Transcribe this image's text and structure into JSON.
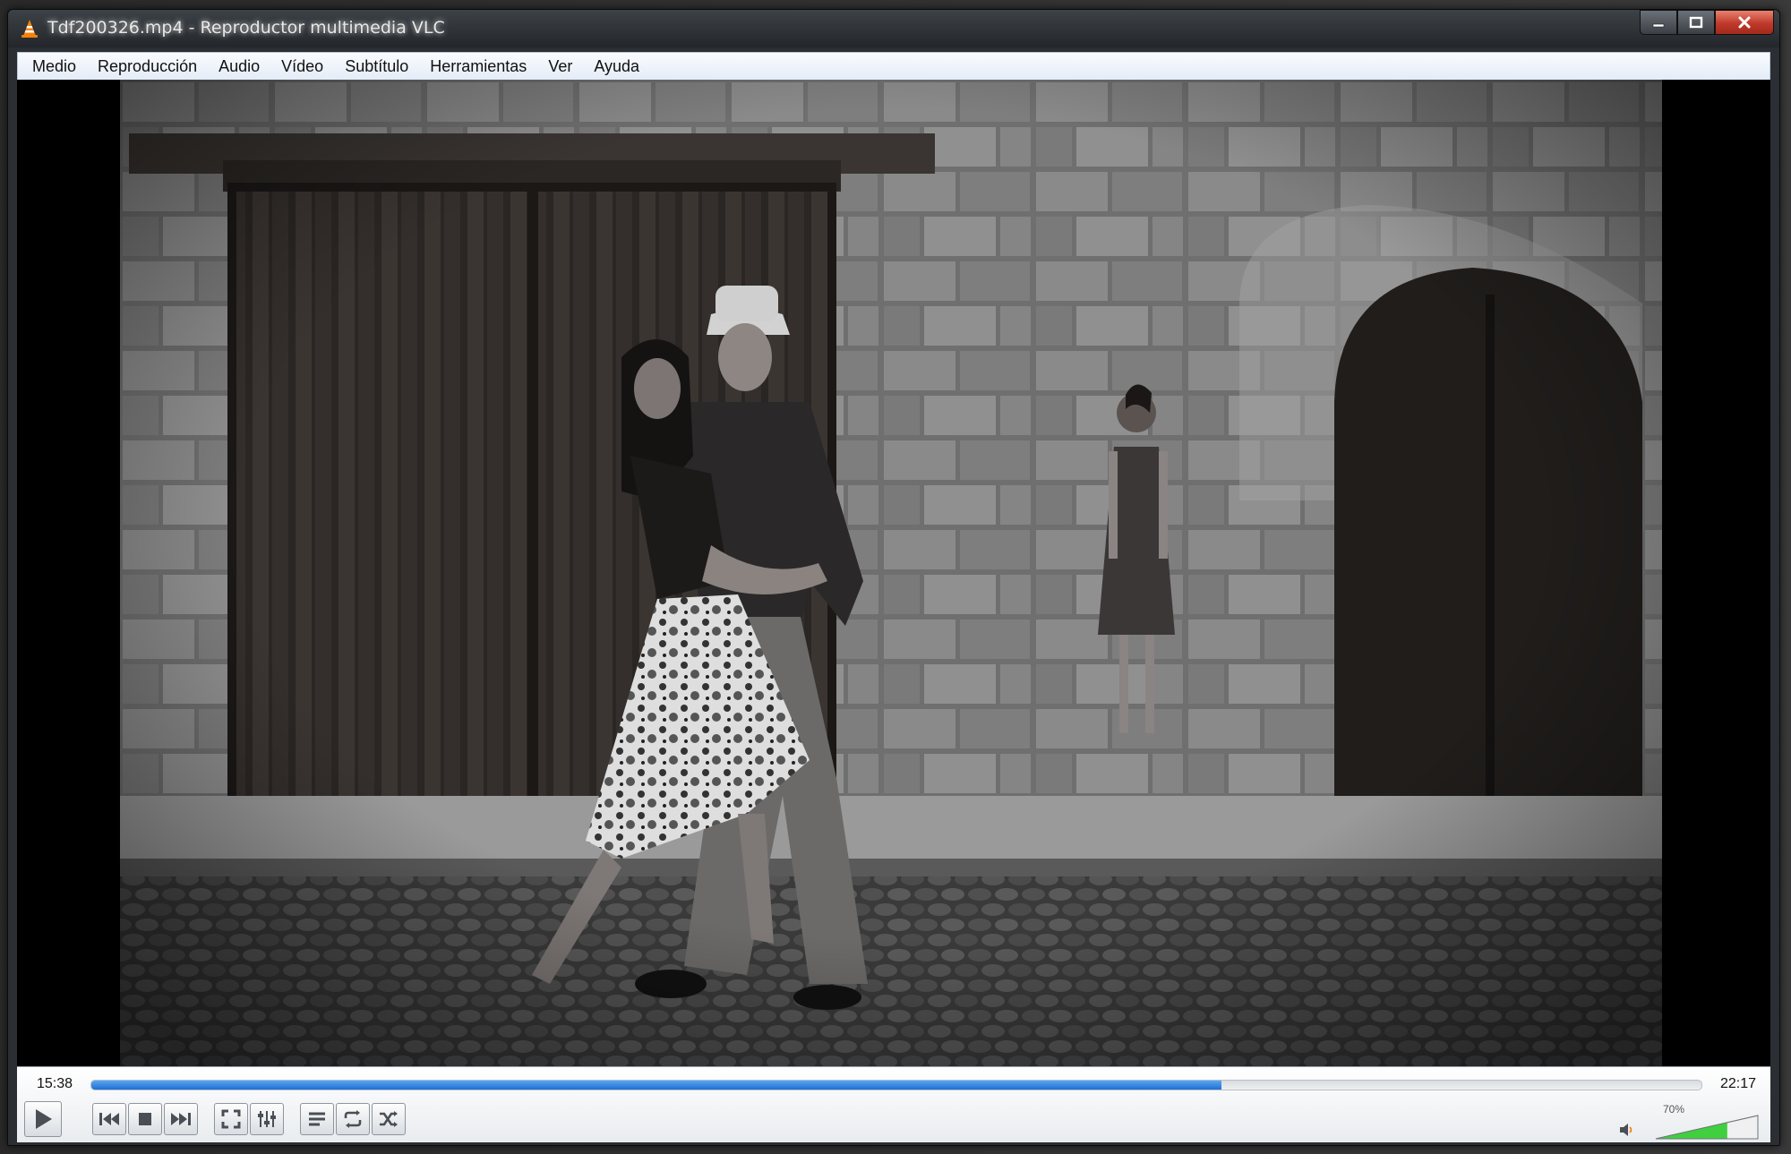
{
  "window": {
    "title": "Tdf200326.mp4 - Reproductor multimedia VLC",
    "app_icon": "vlc-cone-icon"
  },
  "window_buttons": {
    "minimize": "minimize-icon",
    "maximize": "maximize-icon",
    "close": "close-icon"
  },
  "menu": {
    "items": [
      "Medio",
      "Reproducción",
      "Audio",
      "Vídeo",
      "Subtítulo",
      "Herramientas",
      "Ver",
      "Ayuda"
    ]
  },
  "playback": {
    "elapsed": "15:38",
    "total": "22:17",
    "progress_fraction": 0.7017
  },
  "controls": {
    "buttons": [
      "play-icon",
      "previous-icon",
      "stop-icon",
      "next-icon",
      "fullscreen-icon",
      "extended-settings-icon",
      "playlist-icon",
      "loop-icon",
      "shuffle-icon"
    ]
  },
  "volume": {
    "label": "70%",
    "level_fraction": 0.7,
    "icon": "speaker-icon",
    "fill_color": "#3fcf3f"
  }
}
